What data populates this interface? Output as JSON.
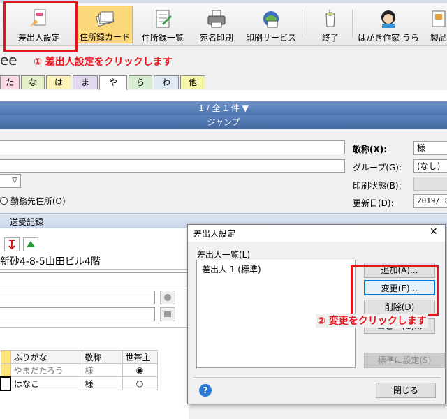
{
  "toolbar": {
    "buttons": [
      {
        "label": "差出人設定",
        "icon": "sender-settings-icon"
      },
      {
        "label": "住所録カード",
        "icon": "address-card-icon"
      },
      {
        "label": "住所録一覧",
        "icon": "address-list-icon"
      },
      {
        "label": "宛名印刷",
        "icon": "printer-icon"
      },
      {
        "label": "印刷サービス",
        "icon": "print-service-icon"
      },
      {
        "label": "終了",
        "icon": "exit-cup-icon"
      },
      {
        "label": "はがき作家 うら",
        "icon": "hagaki-sakka-icon"
      },
      {
        "label": "製品",
        "icon": "product-icon"
      }
    ]
  },
  "annotations": {
    "step1": "① 差出人設定をクリックします",
    "step2": "② 変更をクリックします"
  },
  "partial_name": "ee",
  "kana_tabs": [
    "た",
    "な",
    "は",
    "ま",
    "や",
    "ら",
    "わ",
    "他"
  ],
  "record_bar": {
    "text": "1 / 全 1 件 ▼"
  },
  "jump_bar": {
    "text": "ジャンプ"
  },
  "form": {
    "honorific_label": "敬称(X):",
    "honorific_value": "様",
    "group_label": "グループ(G):",
    "group_value": "(なし)",
    "print_status_label": "印刷状態(B):",
    "updated_label": "更新日(D):",
    "updated_value": "2019/ 8 /",
    "work_address_radio": "勤務先住所(O)",
    "section_title": "送受記録",
    "address_value": "新砂4-8-5山田ビル4階"
  },
  "family_table": {
    "headers": [
      "ふりがな",
      "敬称",
      "世帯主"
    ],
    "rows": [
      {
        "furigana": "やまだたろう",
        "honorific": "様",
        "head": true
      },
      {
        "furigana": "はなこ",
        "honorific": "様",
        "head": false
      }
    ]
  },
  "dialog": {
    "title": "差出人設定",
    "close": "✕",
    "list_label": "差出人一覧(L)",
    "list_items": [
      "差出人 1 (標準)"
    ],
    "add_button": "追加(A)...",
    "change_button": "変更(E)...",
    "delete_button": "削除(D)",
    "copy_button": "コピー(C)...",
    "set_default_button": "標準に設定(S)",
    "close_button": "閉じる",
    "help": "?"
  },
  "colors": {
    "annotation_red": "#e8141c",
    "active_toolbar": "#fbd97a",
    "header_blue": "#4d74b0"
  }
}
